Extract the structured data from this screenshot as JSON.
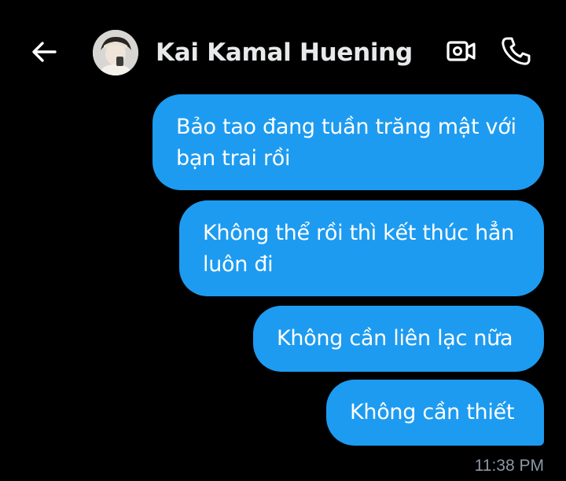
{
  "header": {
    "back_icon": "arrow-left-icon",
    "contact_name": "Kai Kamal Huening",
    "avatar": "contact-avatar",
    "video_icon": "video-camera-icon",
    "call_icon": "phone-icon"
  },
  "messages": [
    {
      "text": "Bảo tao đang tuần trăng mật với\nbạn trai rồi",
      "direction": "outgoing"
    },
    {
      "text": "Không thể rồi thì kết thúc hẳn\nluôn đi",
      "direction": "outgoing"
    },
    {
      "text": "Không cần liên lạc nữa",
      "direction": "outgoing"
    },
    {
      "text": "Không cần thiết",
      "direction": "outgoing"
    }
  ],
  "timestamp": "11:38 PM",
  "colors": {
    "background": "#000000",
    "bubble": "#1d9bf0",
    "name": "#e7e9ea",
    "timestamp": "#8b98a5"
  }
}
